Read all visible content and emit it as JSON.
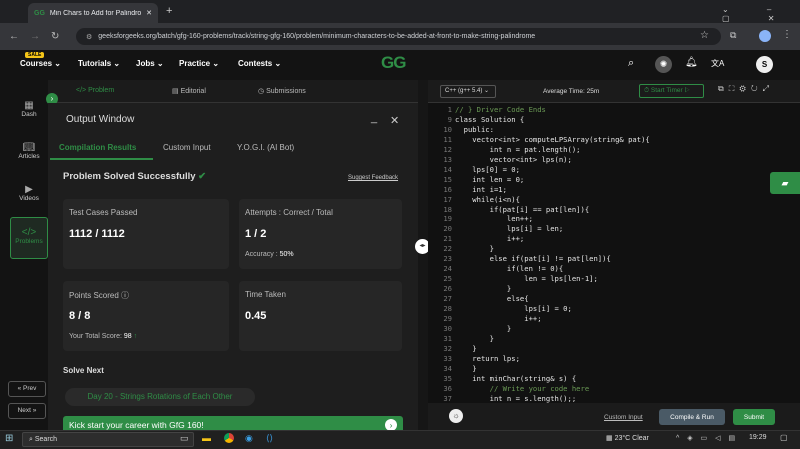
{
  "browser": {
    "tab_title": "Min Chars to Add for Palindrome",
    "url": "geeksforgeeks.org/batch/gfg-160-problems/track/string-gfg-160/problem/minimum-characters-to-be-added-at-front-to-make-string-palindrome"
  },
  "site": {
    "sale_badge": "SALE",
    "nav": [
      "Courses",
      "Tutorials",
      "Jobs",
      "Practice",
      "Contests"
    ],
    "logo": "GG",
    "avatar": "S"
  },
  "rail": {
    "items": [
      "Dash",
      "Articles",
      "Videos",
      "Problems"
    ],
    "prev": "« Prev",
    "next": "Next »"
  },
  "tabs": {
    "problem": "Problem",
    "editorial": "Editorial",
    "submissions": "Submissions"
  },
  "output": {
    "title": "Output Window",
    "subtabs": [
      "Compilation Results",
      "Custom Input",
      "Y.O.G.I. (AI Bot)"
    ],
    "status": "Problem Solved Successfully",
    "suggest": "Suggest Feedback",
    "tc_label": "Test Cases Passed",
    "tc_value": "1112 / 1112",
    "att_label": "Attempts : Correct / Total",
    "att_value": "1 / 2",
    "acc_label": "Accuracy :",
    "acc_value": "50%",
    "pts_label": "Points Scored",
    "pts_value": "8 / 8",
    "total_label": "Your Total Score:",
    "total_value": "98",
    "time_label": "Time Taken",
    "time_value": "0.45",
    "solve_next": "Solve Next",
    "next_problem": "Day 20 - Strings Rotations of Each Other",
    "promo": "Kick start your career with GfG 160!"
  },
  "editor": {
    "lang": "C++ (g++ 5.4)",
    "avg_time": "Average Time: 25m",
    "timer": "Start Timer",
    "lines": [
      {
        "n": "1",
        "t": "// } Driver Code Ends"
      },
      {
        "n": "9",
        "t": "class Solution {"
      },
      {
        "n": "10",
        "t": "  public:"
      },
      {
        "n": "11",
        "t": "    vector<int> computeLPSArray(string& pat){"
      },
      {
        "n": "12",
        "t": "        int n = pat.length();"
      },
      {
        "n": "13",
        "t": "        vector<int> lps(n);"
      },
      {
        "n": "14",
        "t": "    lps[0] = 0;"
      },
      {
        "n": "15",
        "t": "    int len = 0;"
      },
      {
        "n": "16",
        "t": "    int i=1;"
      },
      {
        "n": "17",
        "t": "    while(i<n){"
      },
      {
        "n": "18",
        "t": "        if(pat[i] == pat[len]){"
      },
      {
        "n": "19",
        "t": "            len++;"
      },
      {
        "n": "20",
        "t": "            lps[i] = len;"
      },
      {
        "n": "21",
        "t": "            i++;"
      },
      {
        "n": "22",
        "t": "        }"
      },
      {
        "n": "23",
        "t": "        else if(pat[i] != pat[len]){"
      },
      {
        "n": "24",
        "t": "            if(len != 0){"
      },
      {
        "n": "25",
        "t": "                len = lps[len-1];"
      },
      {
        "n": "26",
        "t": "            }"
      },
      {
        "n": "27",
        "t": "            else{"
      },
      {
        "n": "28",
        "t": "                lps[i] = 0;"
      },
      {
        "n": "29",
        "t": "                i++;"
      },
      {
        "n": "30",
        "t": "            }"
      },
      {
        "n": "31",
        "t": "        }"
      },
      {
        "n": "32",
        "t": "    }"
      },
      {
        "n": "33",
        "t": "    return lps;"
      },
      {
        "n": "34",
        "t": "    }"
      },
      {
        "n": "35",
        "t": "    int minChar(string& s) {"
      },
      {
        "n": "36",
        "t": "        // Write your code here"
      },
      {
        "n": "37",
        "t": "        int n = s.length();;"
      }
    ],
    "custom_input": "Custom Input",
    "compile": "Compile & Run",
    "submit": "Submit"
  },
  "taskbar": {
    "search": "Search",
    "weather": "23°C  Clear",
    "time": "19:29"
  }
}
